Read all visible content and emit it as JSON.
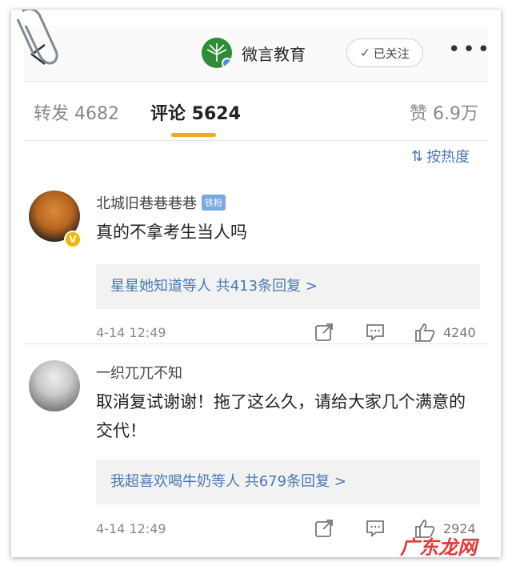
{
  "header": {
    "account_name": "微言教育",
    "follow_label": "已关注",
    "more_label": "•••"
  },
  "tabs": [
    {
      "label": "转发 4682"
    },
    {
      "label": "评论 5624"
    },
    {
      "label": "赞 6.9万"
    }
  ],
  "sort_label": "按热度",
  "comments": [
    {
      "username": "北城旧巷巷巷巷",
      "badge": "铁粉",
      "text": "真的不拿考生当人吗",
      "replies_names": "星星她知道",
      "replies_suffix": "等人",
      "replies_count": "共413条回复 >",
      "time": "4-14 12:49",
      "likes": "4240"
    },
    {
      "username": "一织兀兀不知",
      "text": "取消复试谢谢！拖了这么久，请给大家几个满意的交代！",
      "replies_names": "我超喜欢喝牛奶",
      "replies_suffix": "等人",
      "replies_count": "共679条回复 >",
      "time": "4-14 12:49",
      "likes": "2924"
    }
  ],
  "watermark": "广东龙网",
  "colors": {
    "accent_underline": "#f5a623",
    "link_blue": "#4a78b4",
    "fan_badge": "#7aa8e0",
    "watermark_red": "#e53935"
  }
}
